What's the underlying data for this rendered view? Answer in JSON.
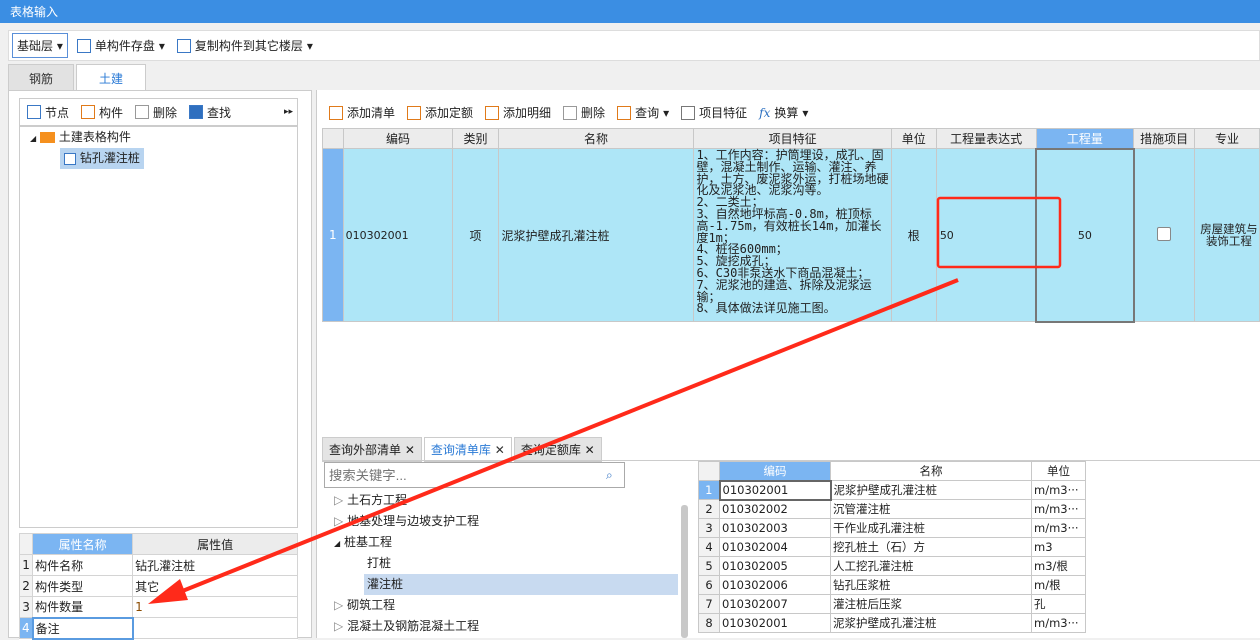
{
  "window_title": "表格输入",
  "toolbar": {
    "floor": "基础层",
    "save_single": "单构件存盘",
    "copy_to_floors": "复制构件到其它楼层"
  },
  "tabs": [
    {
      "label": "钢筋"
    },
    {
      "label": "土建",
      "active": true
    }
  ],
  "left_toolbar": {
    "node": "节点",
    "component": "构件",
    "delete": "删除",
    "find": "查找"
  },
  "tree": {
    "root": "土建表格构件",
    "child": "钻孔灌注桩"
  },
  "properties": {
    "headers": [
      "属性名称",
      "属性值"
    ],
    "rows": [
      {
        "no": "1",
        "name": "构件名称",
        "value": "钻孔灌注桩"
      },
      {
        "no": "2",
        "name": "构件类型",
        "value": "其它"
      },
      {
        "no": "3",
        "name": "构件数量",
        "value": "1"
      },
      {
        "no": "4",
        "name": "备注",
        "value": ""
      }
    ]
  },
  "right_toolbar": {
    "add_list": "添加清单",
    "add_quota": "添加定额",
    "add_detail": "添加明细",
    "delete": "删除",
    "query": "查询",
    "item_feature": "项目特征",
    "convert": "换算"
  },
  "main_grid": {
    "headers": [
      "编码",
      "类别",
      "名称",
      "项目特征",
      "单位",
      "工程量表达式",
      "工程量",
      "措施项目",
      "专业"
    ],
    "row": {
      "no": "1",
      "code": "010302001",
      "type": "项",
      "name": "泥浆护壁成孔灌注桩",
      "features": [
        "1、工作内容：护筒埋设，成孔、固壁，混凝土制作、运输、灌注、养护，土方、废泥浆外运，打桩场地硬化及泥浆池、泥浆沟等。",
        "2、二类土；",
        "3、自然地坪标高-0.8m，桩顶标高-1.75m，有效桩长14m，加灌长度1m；",
        "4、桩径600mm；",
        "5、旋挖成孔；",
        "6、C30非泵送水下商品混凝土；",
        "7、泥浆池的建造、拆除及泥浆运输；",
        "8、具体做法详见施工图。"
      ],
      "unit": "根",
      "expression": "50",
      "quantity": "50",
      "measure_checked": false,
      "specialty": "房屋建筑与装饰工程"
    }
  },
  "bottom_tabs": [
    {
      "label": "查询外部清单"
    },
    {
      "label": "查询清单库",
      "active": true
    },
    {
      "label": "查询定额库"
    }
  ],
  "search": {
    "placeholder": "搜索关键字..."
  },
  "category_tree": [
    {
      "label": "土石方工程",
      "expanded": false,
      "level": 0
    },
    {
      "label": "地基处理与边坡支护工程",
      "expanded": false,
      "level": 0
    },
    {
      "label": "桩基工程",
      "expanded": true,
      "level": 0
    },
    {
      "label": "打桩",
      "level": 1
    },
    {
      "label": "灌注桩",
      "level": 1,
      "selected": true
    },
    {
      "label": "砌筑工程",
      "expanded": false,
      "level": 0
    },
    {
      "label": "混凝土及钢筋混凝土工程",
      "expanded": false,
      "level": 0
    }
  ],
  "list_grid": {
    "headers": [
      "编码",
      "名称",
      "单位"
    ],
    "rows": [
      [
        "1",
        "010302001",
        "泥浆护壁成孔灌注桩",
        "m/m3···"
      ],
      [
        "2",
        "010302002",
        "沉管灌注桩",
        "m/m3···"
      ],
      [
        "3",
        "010302003",
        "干作业成孔灌注桩",
        "m/m3···"
      ],
      [
        "4",
        "010302004",
        "挖孔桩土（石）方",
        "m3"
      ],
      [
        "5",
        "010302005",
        "人工挖孔灌注桩",
        "m3/根"
      ],
      [
        "6",
        "010302006",
        "钻孔压浆桩",
        "m/根"
      ],
      [
        "7",
        "010302007",
        "灌注桩后压浆",
        "孔"
      ],
      [
        "8",
        "010302001",
        "泥浆护壁成孔灌注桩",
        "m/m3···"
      ]
    ]
  },
  "colors": {
    "accent": "#3b8ee3",
    "row_highlight": "#aee6f7",
    "header_selected": "#7bb5f2",
    "annotation": "#ff2a1a"
  }
}
